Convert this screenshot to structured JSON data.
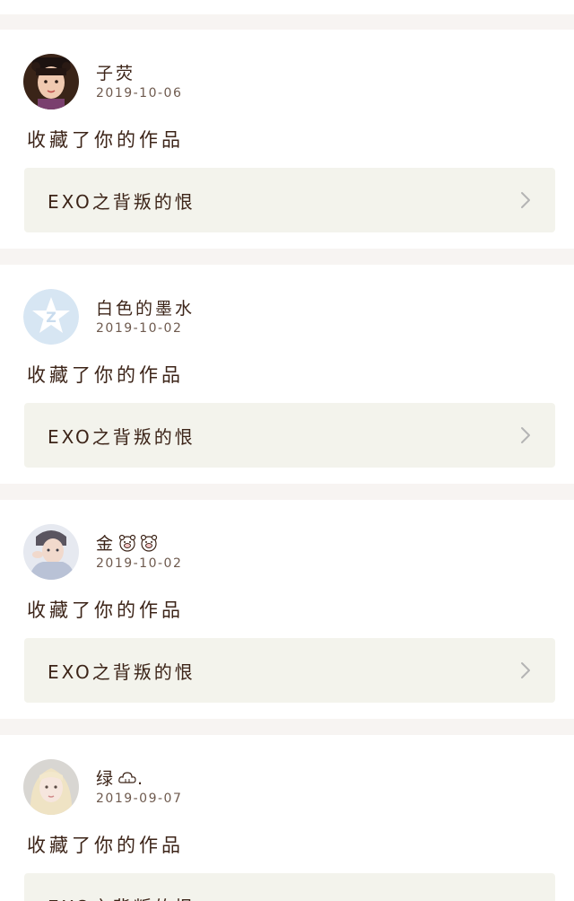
{
  "notifications": [
    {
      "username": "子荧",
      "date": "2019-10-06",
      "action": "收藏了你的作品",
      "work_title": "EXO之背叛的恨",
      "avatar": "portrait-girl-costume"
    },
    {
      "username": "白色的墨水",
      "date": "2019-10-02",
      "action": "收藏了你的作品",
      "work_title": "EXO之背叛的恨",
      "avatar": "qzone-star-icon"
    },
    {
      "username": "金",
      "date": "2019-10-02",
      "action": "收藏了你的作品",
      "work_title": "EXO之背叛的恨",
      "avatar": "portrait-boy"
    },
    {
      "username": "绿",
      "username_suffix": ".",
      "date": "2019-09-07",
      "action": "收藏了你的作品",
      "work_title": "EXO之背叛的恨",
      "avatar": "portrait-blonde"
    }
  ],
  "colors": {
    "page_bg": "#f7f4f2",
    "card_bg": "#ffffff",
    "work_bg": "#f3f3ec",
    "text": "#3c2418",
    "chevron": "#b4b4b4"
  }
}
